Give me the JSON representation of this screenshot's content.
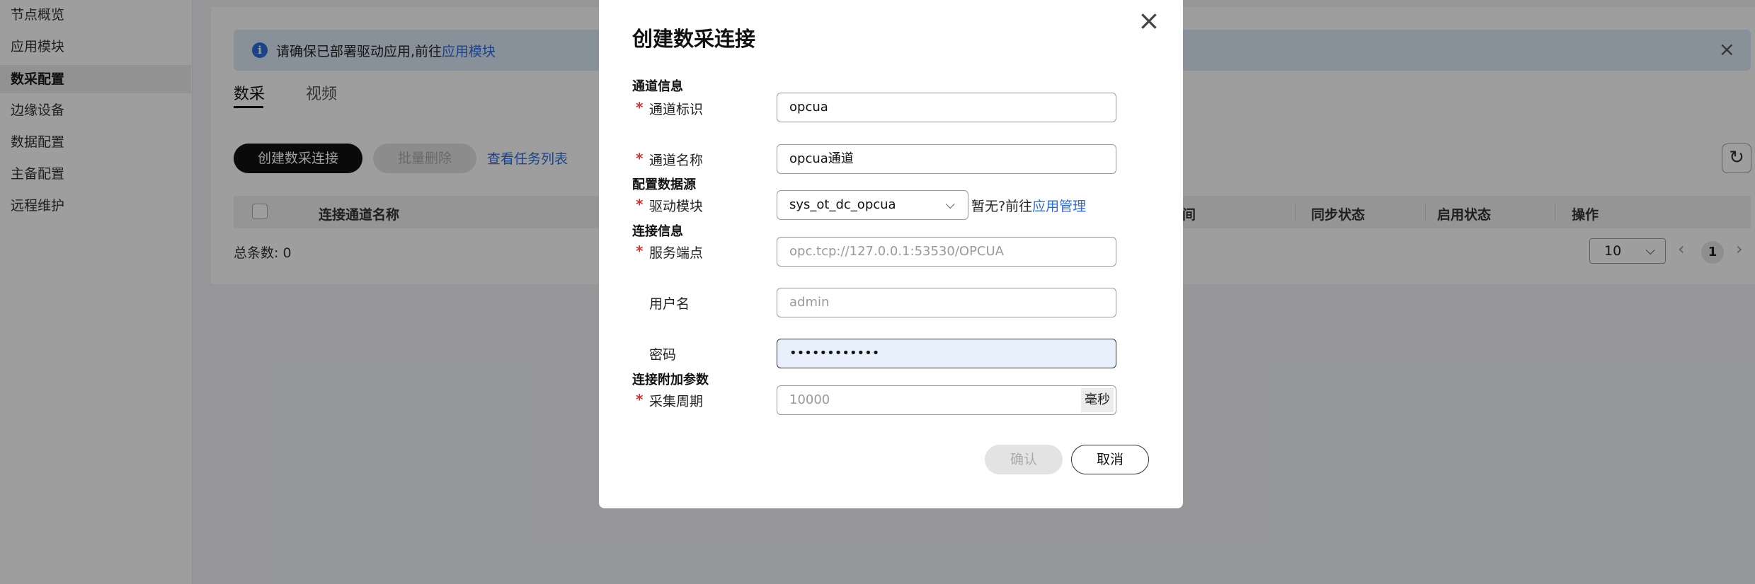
{
  "sidebar": {
    "items": [
      {
        "label": "节点概览"
      },
      {
        "label": "应用模块"
      },
      {
        "label": "数采配置",
        "active": true
      },
      {
        "label": "边缘设备"
      },
      {
        "label": "数据配置"
      },
      {
        "label": "主备配置"
      },
      {
        "label": "远程维护"
      }
    ]
  },
  "banner": {
    "text": "请确保已部署驱动应用,前往",
    "link": "应用模块",
    "close": "×",
    "icon": "i"
  },
  "tabs": [
    {
      "label": "数采",
      "active": true
    },
    {
      "label": "视频"
    }
  ],
  "toolbar": {
    "create_label": "创建数采连接",
    "batch_delete_label": "批量删除",
    "task_list_label": "查看任务列表",
    "refresh_icon": "↻"
  },
  "table": {
    "headers": [
      "连接通道名称",
      "间",
      "同步状态",
      "启用状态",
      "操作"
    ]
  },
  "pagination": {
    "total": "总条数: 0",
    "page_size": "10",
    "current_page": "1",
    "prev": "‹",
    "next": "›",
    "chevron": "⌵"
  },
  "dialog": {
    "title": "创建数采连接",
    "close": "×",
    "sections": {
      "channel": "通道信息",
      "datasource": "配置数据源",
      "connection": "连接信息",
      "extra": "连接附加参数"
    },
    "required_mark": "*",
    "fields": {
      "channel_id": {
        "label": "通道标识",
        "value": "opcua"
      },
      "channel_name": {
        "label": "通道名称",
        "value": "opcua通道"
      },
      "driver": {
        "label": "驱动模块",
        "value": "sys_ot_dc_opcua",
        "hint": "暂无?前往",
        "hint_link": "应用管理"
      },
      "endpoint": {
        "label": "服务端点",
        "placeholder": "opc.tcp://127.0.0.1:53530/OPCUA"
      },
      "username": {
        "label": "用户名",
        "placeholder": "admin"
      },
      "password": {
        "label": "密码",
        "value": "••••••••••••"
      },
      "period": {
        "label": "采集周期",
        "placeholder": "10000",
        "unit": "毫秒"
      }
    },
    "confirm_label": "确认",
    "cancel_label": "取消"
  }
}
